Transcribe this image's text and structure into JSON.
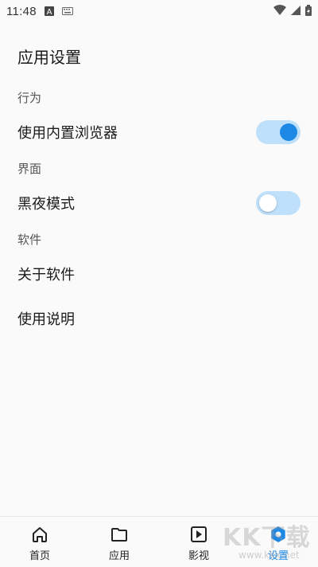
{
  "status_bar": {
    "time": "11:48",
    "icons": [
      "a-icon",
      "keyboard-icon",
      "wifi-icon",
      "signal-icon",
      "battery-charging-icon"
    ]
  },
  "page": {
    "title": "应用设置"
  },
  "sections": [
    {
      "label": "行为"
    },
    {
      "label": "界面"
    },
    {
      "label": "软件"
    }
  ],
  "settings": {
    "builtin_browser": {
      "label": "使用内置浏览器",
      "enabled": true
    },
    "dark_mode": {
      "label": "黑夜模式",
      "enabled": false
    },
    "about": {
      "label": "关于软件"
    },
    "instructions": {
      "label": "使用说明"
    }
  },
  "bottom_nav": {
    "items": [
      {
        "label": "首页",
        "icon": "home-icon"
      },
      {
        "label": "应用",
        "icon": "folder-icon"
      },
      {
        "label": "影视",
        "icon": "play-icon"
      },
      {
        "label": "设置",
        "icon": "settings-icon",
        "active": true
      }
    ]
  },
  "watermark": {
    "text": "KK下载",
    "url": "www.kkx.net"
  },
  "colors": {
    "accent": "#1e88e5",
    "toggle_track": "#bfe0fb",
    "background": "#fafafa"
  }
}
